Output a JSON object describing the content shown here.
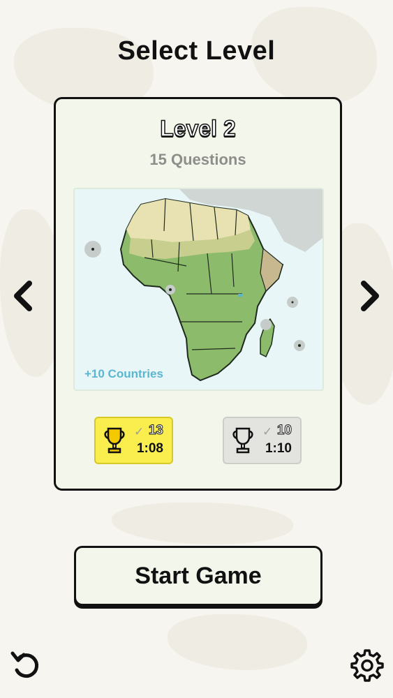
{
  "header": {
    "title": "Select Level"
  },
  "navigation": {
    "prev_icon": "chevron-left-icon",
    "next_icon": "chevron-right-icon"
  },
  "level_card": {
    "title": "Level 2",
    "questions": "15 Questions",
    "map": {
      "region": "Africa",
      "countries_label": "+10 Countries"
    },
    "scores": [
      {
        "tier": "gold",
        "icon": "trophy-icon",
        "correct": "13",
        "time": "1:08"
      },
      {
        "tier": "silver",
        "icon": "trophy-icon",
        "correct": "10",
        "time": "1:10"
      }
    ]
  },
  "start_button": {
    "label": "Start Game"
  },
  "footer": {
    "left_icon": "undo-icon",
    "right_icon": "gear-icon"
  },
  "colors": {
    "background": "#f7f5ef",
    "card": "#f3f6ea",
    "gold": "#f9ee4e",
    "silver": "#e3e4e0",
    "accent_text": "#5bb6cf",
    "muted_text": "#8d8d8a"
  }
}
